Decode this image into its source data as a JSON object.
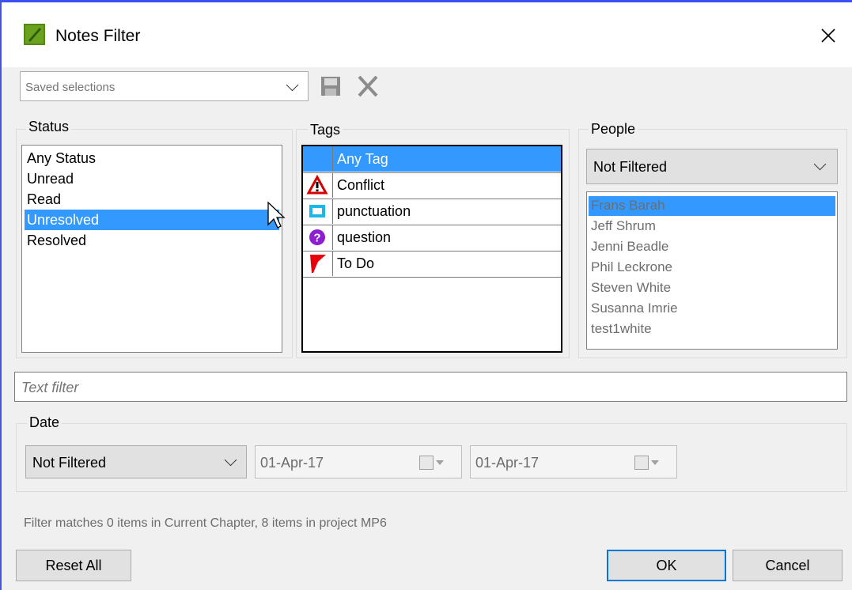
{
  "window": {
    "title": "Notes Filter",
    "close_label": "✕"
  },
  "toolbar": {
    "saved_selections_placeholder": "Saved selections",
    "save_icon": "save-icon",
    "delete_icon": "delete-icon"
  },
  "status": {
    "legend": "Status",
    "items": [
      "Any Status",
      "Unread",
      "Read",
      "Unresolved",
      "Resolved"
    ],
    "selected": "Unresolved"
  },
  "tags": {
    "legend": "Tags",
    "items": [
      {
        "label": "Any Tag",
        "icon": "none",
        "selected": true
      },
      {
        "label": "Conflict",
        "icon": "warning-triangle-icon"
      },
      {
        "label": "punctuation",
        "icon": "punctuation-box-icon"
      },
      {
        "label": "question",
        "icon": "question-circle-icon"
      },
      {
        "label": "To Do",
        "icon": "red-flag-icon"
      }
    ]
  },
  "people": {
    "legend": "People",
    "filter_value": "Not Filtered",
    "items": [
      "Frans Barah",
      "Jeff Shrum",
      "Jenni Beadle",
      "Phil Leckrone",
      "Steven White",
      "Susanna Imrie",
      "test1white"
    ],
    "selected": "Frans Barah"
  },
  "text_filter": {
    "placeholder": "Text filter"
  },
  "date": {
    "legend": "Date",
    "filter_value": "Not Filtered",
    "from": "01-Apr-17",
    "to": "01-Apr-17"
  },
  "footer": {
    "status_text": "Filter matches 0 items in Current Chapter, 8 items in project MP6",
    "reset_label": "Reset All",
    "ok_label": "OK",
    "cancel_label": "Cancel"
  },
  "colors": {
    "selection": "#3399ff",
    "titlebar_border": "#3c4ff0",
    "app_icon_green": "#6aa21f"
  }
}
